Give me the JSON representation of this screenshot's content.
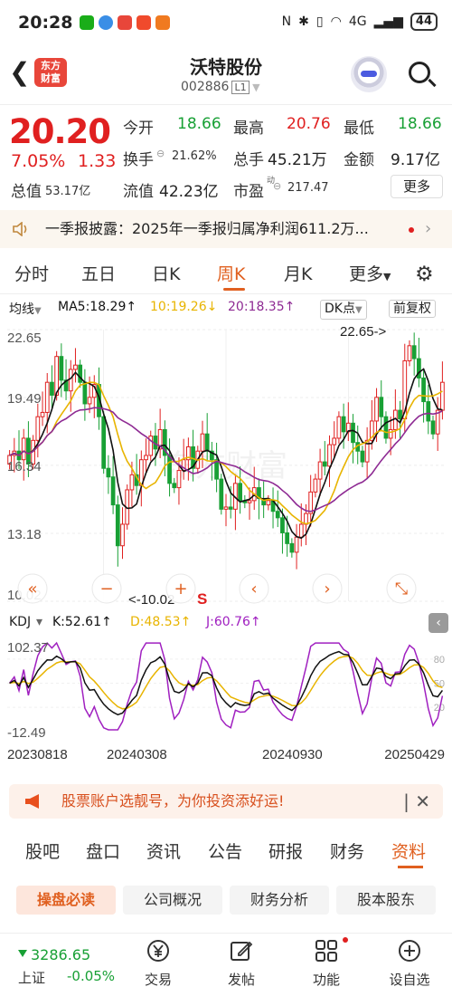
{
  "status": {
    "time": "20:28",
    "battery": "44",
    "net": "4G"
  },
  "header": {
    "title": "沃特股份",
    "code": "002886",
    "level": "L1",
    "logo_top": "东方",
    "logo_bottom": "财富"
  },
  "quote": {
    "price": "20.20",
    "pct": "7.05%",
    "change": "1.33",
    "open_label": "今开",
    "open": "18.66",
    "high_label": "最高",
    "high": "20.76",
    "low_label": "最低",
    "low": "18.66",
    "turnover_label": "换手",
    "turnover": "21.62%",
    "volume_label": "总手",
    "volume": "45.21万",
    "amount_label": "金额",
    "amount": "9.17亿",
    "mcap_label": "总值",
    "mcap": "53.17亿",
    "float_label": "流值",
    "float": "42.23亿",
    "pe_label": "市盈",
    "pe_sup": "动",
    "pe": "217.47",
    "more": "更多"
  },
  "notice": {
    "text": "一季报披露：2025年一季报归属净利润611.2万..."
  },
  "tabs": [
    {
      "label": "分时"
    },
    {
      "label": "五日"
    },
    {
      "label": "日K"
    },
    {
      "label": "周K"
    },
    {
      "label": "月K"
    },
    {
      "label": "更多"
    }
  ],
  "ma": {
    "type": "均线",
    "ma5": "MA5:18.29↑",
    "ma10": "10:19.26↓",
    "ma20": "20:18.35↑",
    "dk": "DK点",
    "fq": "前复权"
  },
  "kdj": {
    "name": "KDJ",
    "k": "K:52.61↑",
    "d": "D:48.53↑",
    "j": "J:60.76↑"
  },
  "colors": {
    "up": "#e02020",
    "down": "#18a035",
    "ma5": "#111111",
    "ma10": "#e8b400",
    "ma20": "#8e2a93",
    "accent": "#e06020"
  },
  "chart_data": {
    "type": "candlestick",
    "period": "weekly",
    "y_ticks": [
      "22.65",
      "19.49",
      "16.34",
      "13.18",
      "10.02"
    ],
    "ylim": [
      10.02,
      22.65
    ],
    "x_ticks": [
      "20230818",
      "20240308",
      "20240930",
      "20250429"
    ],
    "max_label": "22.65->",
    "min_label": "<-10.02",
    "watermark": "东方财富",
    "s_marker": "S",
    "kdj_y_ticks": [
      "102.37",
      "-12.49"
    ],
    "kdj_right_ticks": [
      "80",
      "50",
      "20"
    ],
    "close": [
      16.8,
      17.0,
      16.6,
      17.6,
      16.4,
      17.5,
      18.6,
      18.8,
      20.2,
      19.6,
      21.4,
      20.3,
      19.8,
      20.8,
      21.0,
      20.2,
      19.2,
      19.5,
      20.1,
      18.6,
      16.2,
      15.8,
      14.5,
      12.6,
      13.6,
      15.2,
      15.9,
      15.4,
      16.6,
      16.8,
      17.7,
      17.1,
      18.0,
      16.8,
      15.5,
      15.3,
      16.1,
      16.6,
      17.2,
      16.2,
      17.0,
      17.8,
      17.0,
      16.6,
      15.7,
      14.3,
      14.4,
      14.3,
      15.5,
      14.7,
      14.6,
      14.7,
      15.3,
      14.8,
      14.5,
      14.7,
      14.2,
      13.9,
      13.2,
      12.7,
      12.3,
      13.0,
      13.6,
      14.1,
      15.1,
      15.7,
      16.5,
      16.3,
      17.3,
      17.6,
      18.6,
      17.9,
      18.3,
      17.4,
      17.0,
      16.5,
      17.5,
      18.4,
      19.5,
      18.6,
      17.6,
      18.0,
      18.9,
      18.5,
      21.2,
      21.9,
      21.3,
      20.4,
      19.3,
      18.4,
      17.8,
      18.9,
      20.2
    ]
  },
  "promo": {
    "text": "股票账户选靓号，为你投资添好运!"
  },
  "ftabs": [
    {
      "label": "股吧"
    },
    {
      "label": "盘口"
    },
    {
      "label": "资讯"
    },
    {
      "label": "公告"
    },
    {
      "label": "研报"
    },
    {
      "label": "财务"
    },
    {
      "label": "资料"
    }
  ],
  "pills": [
    {
      "label": "操盘必读"
    },
    {
      "label": "公司概况"
    },
    {
      "label": "财务分析"
    },
    {
      "label": "股本股东"
    }
  ],
  "index": {
    "value": "3286.65",
    "name": "上证",
    "pct": "-0.05%"
  },
  "bottom": [
    {
      "label": "交易"
    },
    {
      "label": "发帖"
    },
    {
      "label": "功能"
    },
    {
      "label": "设自选"
    }
  ]
}
